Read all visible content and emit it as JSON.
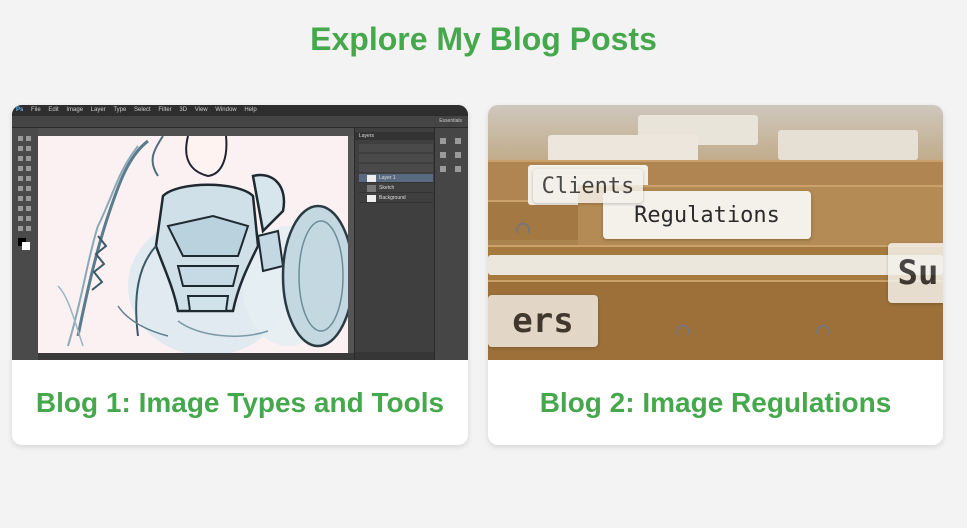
{
  "page": {
    "title": "Explore My Blog Posts"
  },
  "cards": [
    {
      "title": "Blog 1: Image Types and Tools",
      "image": {
        "app_logo": "Ps",
        "menu": [
          "File",
          "Edit",
          "Image",
          "Layer",
          "Type",
          "Select",
          "Filter",
          "3D",
          "View",
          "Window",
          "Help"
        ],
        "panel_label": "Layers",
        "layers": [
          "Layer 1",
          "Sketch",
          "Background"
        ],
        "workspace_label": "Essentials"
      }
    },
    {
      "title": "Blog 2: Image Regulations",
      "image": {
        "tabs": [
          "Regulations",
          "Clients",
          "ers",
          "Su"
        ]
      }
    }
  ]
}
